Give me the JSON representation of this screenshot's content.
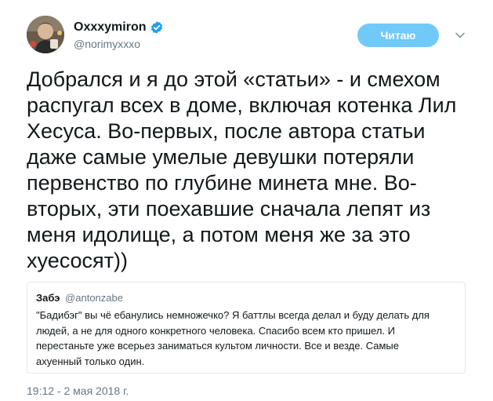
{
  "author": {
    "display_name": "Oxxxymiron",
    "handle": "@norimyxxxo",
    "verified": true
  },
  "follow_button": {
    "label": "Читаю"
  },
  "tweet": {
    "lines": [
      "Добрался и я до этой «статьи» - и смехом",
      "распугал всех в доме, включая котенка Лил",
      "Хесуса. Во-первых, после автора статьи",
      "даже самые умелые девушки потеряли",
      "первенство по глубине минета мне. Во-",
      "вторых, эти поехавшие сначала лепят из",
      "меня идолище, а потом меня же за это",
      "хуесосят))"
    ]
  },
  "quoted_tweet": {
    "name": "Забэ",
    "handle": "@antonzabe",
    "lines": [
      "\"Бадибэг\" вы чё ебанулись немножечко? Я баттлы всегда делал и буду делать для",
      "людей, а не для одного конкретного человека. Спасибо всем кто пришел. И",
      "перестаньте уже всерьез заниматься культом личности. Все и везде. Самые",
      "ахуенный только один."
    ]
  },
  "timestamp": "19:12 - 2 мая 2018 г.",
  "colors": {
    "verified": "#1da1f2",
    "follow_button_bg": "#71c9f8",
    "secondary_text": "#657786",
    "border": "#e1e8ed"
  },
  "icons": {
    "verified": "verified-badge-icon",
    "caret": "chevron-down-icon"
  }
}
